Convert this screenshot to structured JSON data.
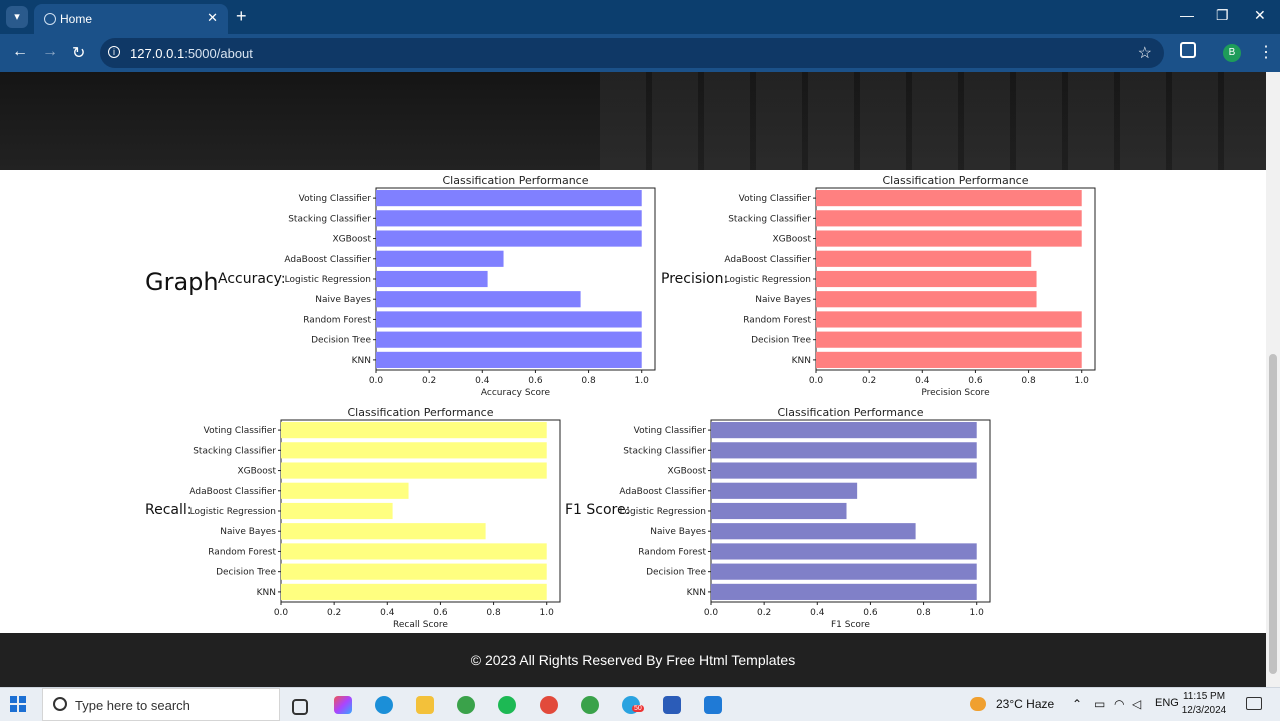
{
  "browser": {
    "tab_title": "Home",
    "url_host": "127.0.0.1",
    "url_path": ":5000/about",
    "profile_initial": "B"
  },
  "page": {
    "graph_heading": "Graph",
    "labels": {
      "accuracy": "Accuracy:",
      "precision": "Precision:",
      "recall": "Recall:",
      "f1": "F1 Score:"
    },
    "footer": "© 2023 All Rights Reserved By Free Html Templates"
  },
  "chart_data": [
    {
      "type": "bar",
      "orientation": "horizontal",
      "title": "Classification Performance",
      "xlabel": "Accuracy Score",
      "xlim": [
        0,
        1.05
      ],
      "xticks": [
        "0.0",
        "0.2",
        "0.4",
        "0.6",
        "0.8",
        "1.0"
      ],
      "categories": [
        "Voting Classifier",
        "Stacking Classifier",
        "XGBoost",
        "AdaBoost Classifier",
        "Logistic Regression",
        "Naive Bayes",
        "Random Forest",
        "Decision Tree",
        "KNN"
      ],
      "values": [
        1.0,
        1.0,
        1.0,
        0.48,
        0.42,
        0.77,
        1.0,
        1.0,
        1.0
      ],
      "color": "#8080ff"
    },
    {
      "type": "bar",
      "orientation": "horizontal",
      "title": "Classification Performance",
      "xlabel": "Precision Score",
      "xlim": [
        0,
        1.05
      ],
      "xticks": [
        "0.0",
        "0.2",
        "0.4",
        "0.6",
        "0.8",
        "1.0"
      ],
      "categories": [
        "Voting Classifier",
        "Stacking Classifier",
        "XGBoost",
        "AdaBoost Classifier",
        "Logistic Regression",
        "Naive Bayes",
        "Random Forest",
        "Decision Tree",
        "KNN"
      ],
      "values": [
        1.0,
        1.0,
        1.0,
        0.81,
        0.83,
        0.83,
        1.0,
        1.0,
        1.0
      ],
      "color": "#ff8080"
    },
    {
      "type": "bar",
      "orientation": "horizontal",
      "title": "Classification Performance",
      "xlabel": "Recall Score",
      "xlim": [
        0,
        1.05
      ],
      "xticks": [
        "0.0",
        "0.2",
        "0.4",
        "0.6",
        "0.8",
        "1.0"
      ],
      "categories": [
        "Voting Classifier",
        "Stacking Classifier",
        "XGBoost",
        "AdaBoost Classifier",
        "Logistic Regression",
        "Naive Bayes",
        "Random Forest",
        "Decision Tree",
        "KNN"
      ],
      "values": [
        1.0,
        1.0,
        1.0,
        0.48,
        0.42,
        0.77,
        1.0,
        1.0,
        1.0
      ],
      "color": "#ffff80"
    },
    {
      "type": "bar",
      "orientation": "horizontal",
      "title": "Classification Performance",
      "xlabel": "F1 Score",
      "xlim": [
        0,
        1.05
      ],
      "xticks": [
        "0.0",
        "0.2",
        "0.4",
        "0.6",
        "0.8",
        "1.0"
      ],
      "categories": [
        "Voting Classifier",
        "Stacking Classifier",
        "XGBoost",
        "AdaBoost Classifier",
        "Logistic Regression",
        "Naive Bayes",
        "Random Forest",
        "Decision Tree",
        "KNN"
      ],
      "values": [
        1.0,
        1.0,
        1.0,
        0.55,
        0.51,
        0.77,
        1.0,
        1.0,
        1.0
      ],
      "color": "#8080c8"
    }
  ],
  "taskbar": {
    "search_placeholder": "Type here to search",
    "weather": "23°C  Haze",
    "lang": "ENG",
    "time": "11:15 PM",
    "date": "12/3/2024",
    "telegram_badge": "50"
  }
}
